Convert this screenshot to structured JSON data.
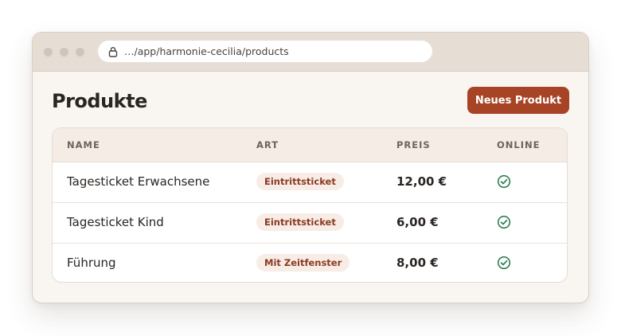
{
  "browser": {
    "url": "…/app/harmonie-cecilia/products"
  },
  "page": {
    "title": "Produkte",
    "new_button_label": "Neues Produkt"
  },
  "table": {
    "columns": [
      "NAME",
      "ART",
      "PREIS",
      "ONLINE"
    ],
    "rows": [
      {
        "name": "Tagesticket Erwachsene",
        "type": "Eintrittsticket",
        "price": "12,00 €",
        "online": true,
        "online_icon": "check-circle-icon"
      },
      {
        "name": "Tagesticket Kind",
        "type": "Eintrittsticket",
        "price": "6,00 €",
        "online": true,
        "online_icon": "check-circle-icon"
      },
      {
        "name": "Führung",
        "type": "Mit Zeitfenster",
        "price": "8,00 €",
        "online": true,
        "online_icon": "check-circle-icon"
      }
    ]
  },
  "colors": {
    "accent": "#a84426",
    "badge_bg": "#f8ece6",
    "badge_text": "#8a3a22",
    "online_green": "#2e7d4f",
    "window_bg": "#f9f6f1",
    "titlebar_bg": "#e6ddd5"
  }
}
